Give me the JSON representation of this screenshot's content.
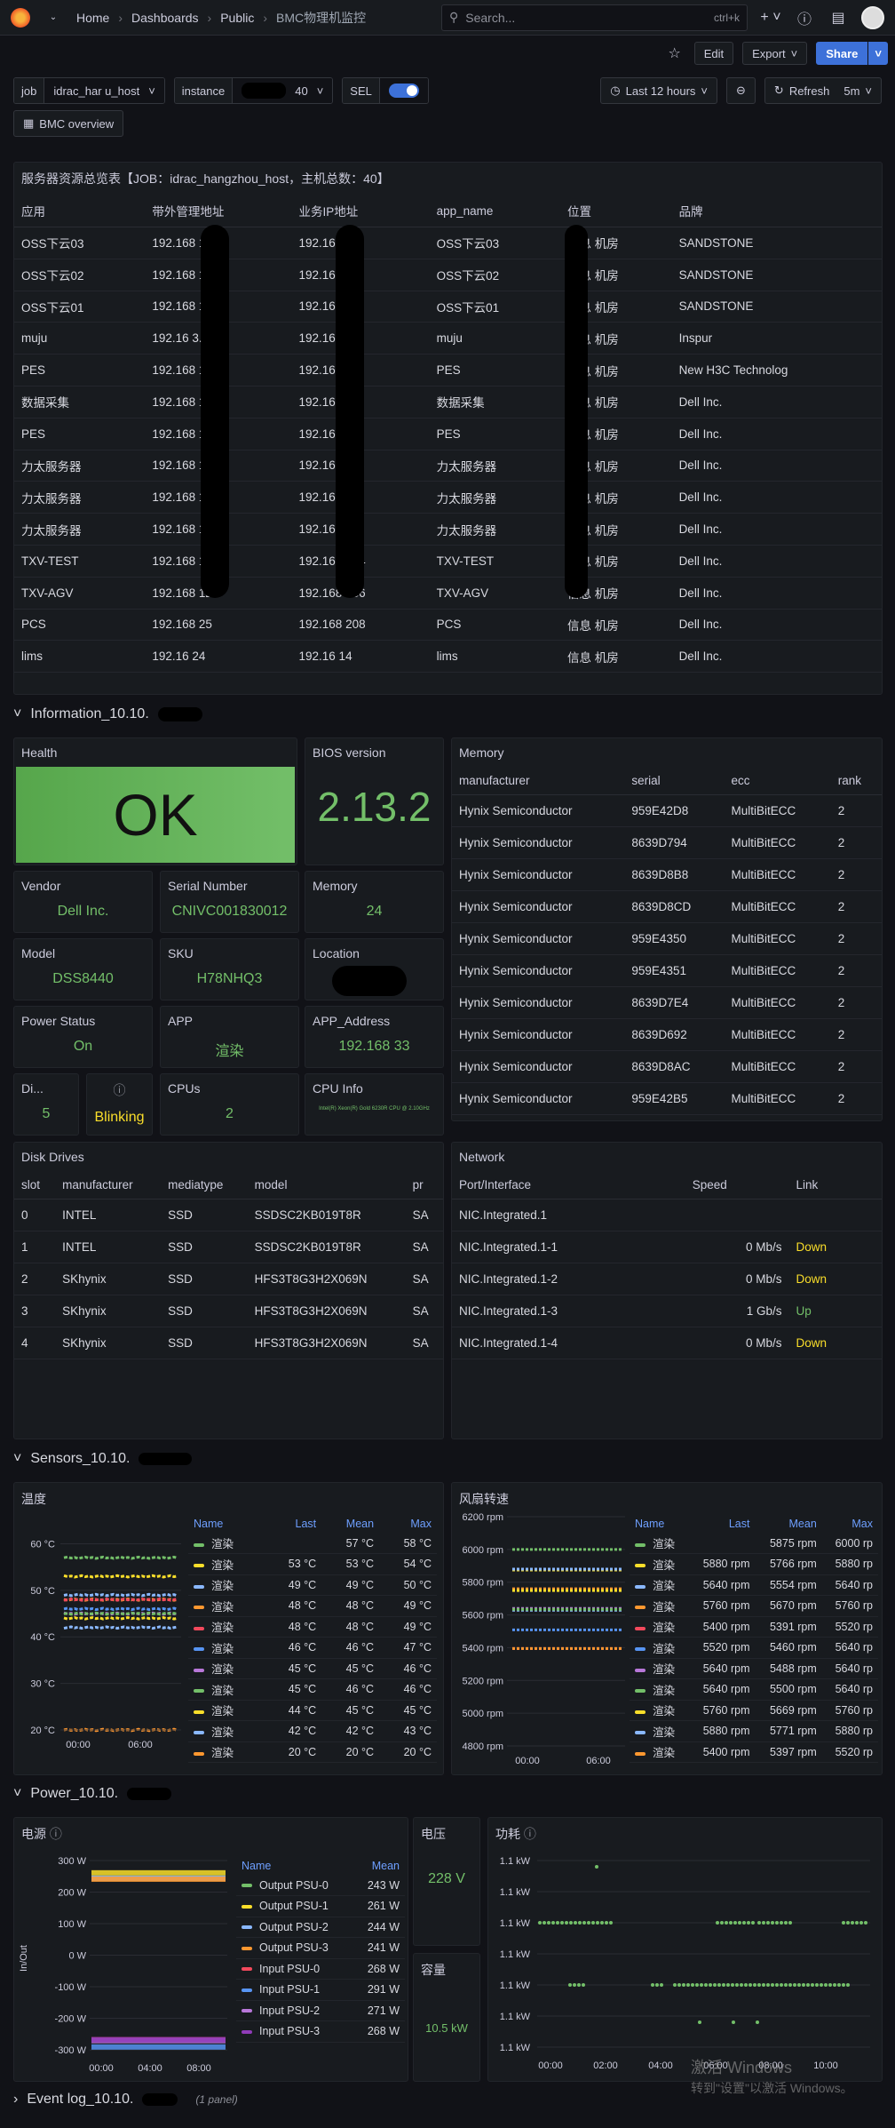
{
  "nav": {
    "crumbs": [
      "Home",
      "Dashboards",
      "Public",
      "BMC物理机监控"
    ],
    "search_placeholder": "Search...",
    "search_shortcut": "ctrl+k"
  },
  "actions": {
    "edit": "Edit",
    "export": "Export",
    "share": "Share"
  },
  "vars": {
    "job_label": "job",
    "job_value": "idrac_har     u_host",
    "instance_label": "instance",
    "instance_value": "40",
    "sel_label": "SEL",
    "time": "Last 12 hours",
    "refresh": "Refresh",
    "interval": "5m",
    "link": "BMC overview"
  },
  "overview": {
    "title": "服务器资源总览表【JOB：idrac_hangzhou_host，主机总数：40】",
    "columns": [
      "应用",
      "带外管理地址",
      "业务IP地址",
      "app_name",
      "位置",
      "品牌"
    ],
    "rows": [
      [
        "OSS下云03",
        "192.168   143",
        "192.168   .44",
        "OSS下云03",
        "信息   机房",
        "SANDSTONE"
      ],
      [
        "OSS下云02",
        "192.168   142",
        "192.168   .44",
        "OSS下云02",
        "信息   机房",
        "SANDSTONE"
      ],
      [
        "OSS下云01",
        "192.168   141",
        "192.168   .44",
        "OSS下云01",
        "信息   机房",
        "SANDSTONE"
      ],
      [
        "muju",
        "192.16   3.106",
        "192.168   21",
        "muju",
        "信息   机房",
        "Inspur"
      ],
      [
        "PES",
        "192.168   121",
        "192.168   25",
        "PES",
        "信息   机房",
        "New H3C Technolog"
      ],
      [
        "数据采集",
        "192.168   110",
        "192.168   23",
        "数据采集",
        "信息   机房",
        "Dell Inc."
      ],
      [
        "PES",
        "192.168   100",
        "192.168   5",
        "PES",
        "信息   机房",
        "Dell Inc."
      ],
      [
        "力太服务器",
        "192.168   138",
        "192.168   113",
        "力太服务器",
        "信息   机房",
        "Dell Inc."
      ],
      [
        "力太服务器",
        "192.168   137",
        "192.168   112",
        "力太服务器",
        "信息   机房",
        "Dell Inc."
      ],
      [
        "力太服务器",
        "192.168   136",
        "192.168   111",
        "力太服务器",
        "信息   机房",
        "Dell Inc."
      ],
      [
        "TXV-TEST",
        "192.168   132",
        "192.168   124",
        "TXV-TEST",
        "信息   机房",
        "Dell Inc."
      ],
      [
        "TXV-AGV",
        "192.168   128",
        "192.168   136",
        "TXV-AGV",
        "信息   机房",
        "Dell Inc."
      ],
      [
        "PCS",
        "192.168   25",
        "192.168   208",
        "PCS",
        "信息   机房",
        "Dell Inc."
      ],
      [
        "lims",
        "192.16   24",
        "192.16   14",
        "lims",
        "信息   机房",
        "Dell Inc."
      ]
    ]
  },
  "info_row": "Information_10.10.",
  "health": {
    "title": "Health",
    "value": "OK"
  },
  "bios": {
    "title": "BIOS version",
    "value": "2.13.2"
  },
  "stats": [
    {
      "title": "Vendor",
      "value": "Dell Inc."
    },
    {
      "title": "Serial Number",
      "value": "CNIVC001830012"
    },
    {
      "title": "Memory",
      "value": "24"
    },
    {
      "title": "Model",
      "value": "DSS8440"
    },
    {
      "title": "SKU",
      "value": "H78NHQ3"
    },
    {
      "title": "Location",
      "value": ""
    },
    {
      "title": "Power Status",
      "value": "On"
    },
    {
      "title": "APP",
      "value": "渲染"
    },
    {
      "title": "APP_Address",
      "value": "192.168   33"
    },
    {
      "title": "Di...",
      "value": "5"
    },
    {
      "title": "",
      "value": "Blinking"
    },
    {
      "title": "CPUs",
      "value": "2"
    },
    {
      "title": "CPU Info",
      "value": "Intel(R) Xeon(R) Gold 6230R CPU @ 2.10GHz"
    }
  ],
  "memory": {
    "title": "Memory",
    "columns": [
      "manufacturer",
      "serial",
      "ecc",
      "rank"
    ],
    "rows": [
      [
        "Hynix Semiconductor",
        "959E42D8",
        "MultiBitECC",
        "2"
      ],
      [
        "Hynix Semiconductor",
        "8639D794",
        "MultiBitECC",
        "2"
      ],
      [
        "Hynix Semiconductor",
        "8639D8B8",
        "MultiBitECC",
        "2"
      ],
      [
        "Hynix Semiconductor",
        "8639D8CD",
        "MultiBitECC",
        "2"
      ],
      [
        "Hynix Semiconductor",
        "959E4350",
        "MultiBitECC",
        "2"
      ],
      [
        "Hynix Semiconductor",
        "959E4351",
        "MultiBitECC",
        "2"
      ],
      [
        "Hynix Semiconductor",
        "8639D7E4",
        "MultiBitECC",
        "2"
      ],
      [
        "Hynix Semiconductor",
        "8639D692",
        "MultiBitECC",
        "2"
      ],
      [
        "Hynix Semiconductor",
        "8639D8AC",
        "MultiBitECC",
        "2"
      ],
      [
        "Hynix Semiconductor",
        "959E42B5",
        "MultiBitECC",
        "2"
      ]
    ]
  },
  "disks": {
    "title": "Disk Drives",
    "columns": [
      "slot",
      "manufacturer",
      "mediatype",
      "model",
      "pr"
    ],
    "rows": [
      [
        "0",
        "INTEL",
        "SSD",
        "SSDSC2KB019T8R",
        "SA"
      ],
      [
        "1",
        "INTEL",
        "SSD",
        "SSDSC2KB019T8R",
        "SA"
      ],
      [
        "2",
        "SKhynix",
        "SSD",
        "HFS3T8G3H2X069N",
        "SA"
      ],
      [
        "3",
        "SKhynix",
        "SSD",
        "HFS3T8G3H2X069N",
        "SA"
      ],
      [
        "4",
        "SKhynix",
        "SSD",
        "HFS3T8G3H2X069N",
        "SA"
      ]
    ]
  },
  "network": {
    "title": "Network",
    "columns": [
      "Port/Interface",
      "Speed",
      "Link"
    ],
    "rows": [
      [
        "NIC.Integrated.1",
        "",
        ""
      ],
      [
        "NIC.Integrated.1-1",
        "0 Mb/s",
        "Down"
      ],
      [
        "NIC.Integrated.1-2",
        "0 Mb/s",
        "Down"
      ],
      [
        "NIC.Integrated.1-3",
        "1 Gb/s",
        "Up"
      ],
      [
        "NIC.Integrated.1-4",
        "0 Mb/s",
        "Down"
      ]
    ]
  },
  "sensors_row": "Sensors_10.10.",
  "temp": {
    "title": "温度",
    "yticks": [
      "60 °C",
      "50 °C",
      "40 °C",
      "30 °C",
      "20 °C"
    ],
    "xticks": [
      "00:00",
      "06:00"
    ],
    "columns": [
      "Name",
      "Last",
      "Mean",
      "Max"
    ],
    "rows": [
      [
        "渲染",
        "",
        "57 °C",
        "58 °C",
        "#73bf69"
      ],
      [
        "渲染",
        "53 °C",
        "53 °C",
        "54 °C",
        "#fade2a"
      ],
      [
        "渲染",
        "49 °C",
        "49 °C",
        "50 °C",
        "#8ab8ff"
      ],
      [
        "渲染",
        "48 °C",
        "48 °C",
        "49 °C",
        "#ff9830"
      ],
      [
        "渲染",
        "48 °C",
        "48 °C",
        "49 °C",
        "#f2495c"
      ],
      [
        "渲染",
        "46 °C",
        "46 °C",
        "47 °C",
        "#5794f2"
      ],
      [
        "渲染",
        "45 °C",
        "45 °C",
        "46 °C",
        "#b877d9"
      ],
      [
        "渲染",
        "45 °C",
        "46 °C",
        "46 °C",
        "#73bf69"
      ],
      [
        "渲染",
        "44 °C",
        "45 °C",
        "45 °C",
        "#fade2a"
      ],
      [
        "渲染",
        "42 °C",
        "42 °C",
        "43 °C",
        "#8ab8ff"
      ],
      [
        "渲染",
        "20 °C",
        "20 °C",
        "20 °C",
        "#ff9830"
      ]
    ]
  },
  "fan": {
    "title": "风扇转速",
    "yticks": [
      "6200 rpm",
      "6000 rpm",
      "5800 rpm",
      "5600 rpm",
      "5400 rpm",
      "5200 rpm",
      "5000 rpm",
      "4800 rpm"
    ],
    "xticks": [
      "00:00",
      "06:00"
    ],
    "columns": [
      "Name",
      "Last",
      "Mean",
      "Max"
    ],
    "rows": [
      [
        "渲染",
        "",
        "5875 rpm",
        "6000 rp",
        "#73bf69"
      ],
      [
        "渲染",
        "5880 rpm",
        "5766 rpm",
        "5880 rp",
        "#fade2a"
      ],
      [
        "渲染",
        "5640 rpm",
        "5554 rpm",
        "5640 rp",
        "#8ab8ff"
      ],
      [
        "渲染",
        "5760 rpm",
        "5670 rpm",
        "5760 rp",
        "#ff9830"
      ],
      [
        "渲染",
        "5400 rpm",
        "5391 rpm",
        "5520 rp",
        "#f2495c"
      ],
      [
        "渲染",
        "5520 rpm",
        "5460 rpm",
        "5640 rp",
        "#5794f2"
      ],
      [
        "渲染",
        "5640 rpm",
        "5488 rpm",
        "5640 rp",
        "#b877d9"
      ],
      [
        "渲染",
        "5640 rpm",
        "5500 rpm",
        "5640 rp",
        "#73bf69"
      ],
      [
        "渲染",
        "5760 rpm",
        "5669 rpm",
        "5760 rp",
        "#fade2a"
      ],
      [
        "渲染",
        "5880 rpm",
        "5771 rpm",
        "5880 rp",
        "#8ab8ff"
      ],
      [
        "渲染",
        "5400 rpm",
        "5397 rpm",
        "5520 rp",
        "#ff9830"
      ]
    ]
  },
  "power_row": "Power_10.10.",
  "psu": {
    "title": "电源",
    "ylabel": "In/Out",
    "yticks": [
      "300 W",
      "200 W",
      "100 W",
      "0 W",
      "-100 W",
      "-200 W",
      "-300 W"
    ],
    "xticks": [
      "00:00",
      "04:00",
      "08:00"
    ],
    "columns": [
      "Name",
      "Mean"
    ],
    "rows": [
      [
        "Output PSU-0",
        "243 W",
        "#73bf69"
      ],
      [
        "Output PSU-1",
        "261 W",
        "#fade2a"
      ],
      [
        "Output PSU-2",
        "244 W",
        "#8ab8ff"
      ],
      [
        "Output PSU-3",
        "241 W",
        "#ff9830"
      ],
      [
        "Input PSU-0",
        "268 W",
        "#f2495c"
      ],
      [
        "Input PSU-1",
        "291 W",
        "#5794f2"
      ],
      [
        "Input PSU-2",
        "271 W",
        "#b877d9"
      ],
      [
        "Input PSU-3",
        "268 W",
        "#8f3bb8"
      ]
    ]
  },
  "voltage": {
    "title": "电压",
    "value": "228 V"
  },
  "capacity": {
    "title": "容量",
    "value": "10.5 kW"
  },
  "powerline": {
    "title": "功耗",
    "yticks": [
      "1.1 kW",
      "1.1 kW",
      "1.1 kW",
      "1.1 kW",
      "1.1 kW",
      "1.1 kW",
      "1.1 kW"
    ],
    "xticks": [
      "00:00",
      "02:00",
      "04:00",
      "06:00",
      "08:00",
      "10:00"
    ]
  },
  "event_row": "Event log_10.10.",
  "event_count": "(1 panel)",
  "watermark": [
    "激活 Windows",
    "转到\"设置\"以激活 Windows。"
  ],
  "chart_data": [
    {
      "type": "line",
      "title": "温度",
      "ylim": [
        20,
        62
      ],
      "series": [
        {
          "name": "渲染",
          "values": [
            57
          ]
        },
        {
          "name": "渲染",
          "values": [
            53
          ]
        },
        {
          "name": "渲染",
          "values": [
            49
          ]
        },
        {
          "name": "渲染",
          "values": [
            48
          ]
        },
        {
          "name": "渲染",
          "values": [
            48
          ]
        },
        {
          "name": "渲染",
          "values": [
            46
          ]
        },
        {
          "name": "渲染",
          "values": [
            45
          ]
        },
        {
          "name": "渲染",
          "values": [
            45
          ]
        },
        {
          "name": "渲染",
          "values": [
            44
          ]
        },
        {
          "name": "渲染",
          "values": [
            42
          ]
        },
        {
          "name": "渲染",
          "values": [
            20
          ]
        }
      ]
    },
    {
      "type": "line",
      "title": "风扇转速",
      "ylim": [
        4800,
        6200
      ],
      "series": [
        {
          "name": "渲染",
          "values": [
            6000
          ]
        },
        {
          "name": "渲染",
          "values": [
            5880
          ]
        },
        {
          "name": "渲染",
          "values": [
            5640
          ]
        },
        {
          "name": "渲染",
          "values": [
            5760
          ]
        },
        {
          "name": "渲染",
          "values": [
            5400
          ]
        },
        {
          "name": "渲染",
          "values": [
            5520
          ]
        },
        {
          "name": "渲染",
          "values": [
            5640
          ]
        },
        {
          "name": "渲染",
          "values": [
            5640
          ]
        },
        {
          "name": "渲染",
          "values": [
            5760
          ]
        },
        {
          "name": "渲染",
          "values": [
            5880
          ]
        },
        {
          "name": "渲染",
          "values": [
            5400
          ]
        }
      ]
    },
    {
      "type": "line",
      "title": "电源",
      "ylim": [
        -300,
        300
      ],
      "series": [
        {
          "name": "Output PSU-0",
          "values": [
            243
          ]
        },
        {
          "name": "Output PSU-1",
          "values": [
            261
          ]
        },
        {
          "name": "Output PSU-2",
          "values": [
            244
          ]
        },
        {
          "name": "Output PSU-3",
          "values": [
            241
          ]
        },
        {
          "name": "Input PSU-0",
          "values": [
            -268
          ]
        },
        {
          "name": "Input PSU-1",
          "values": [
            -291
          ]
        },
        {
          "name": "Input PSU-2",
          "values": [
            -271
          ]
        },
        {
          "name": "Input PSU-3",
          "values": [
            -268
          ]
        }
      ]
    },
    {
      "type": "scatter",
      "title": "功耗",
      "series": [
        {
          "values": []
        }
      ]
    }
  ]
}
